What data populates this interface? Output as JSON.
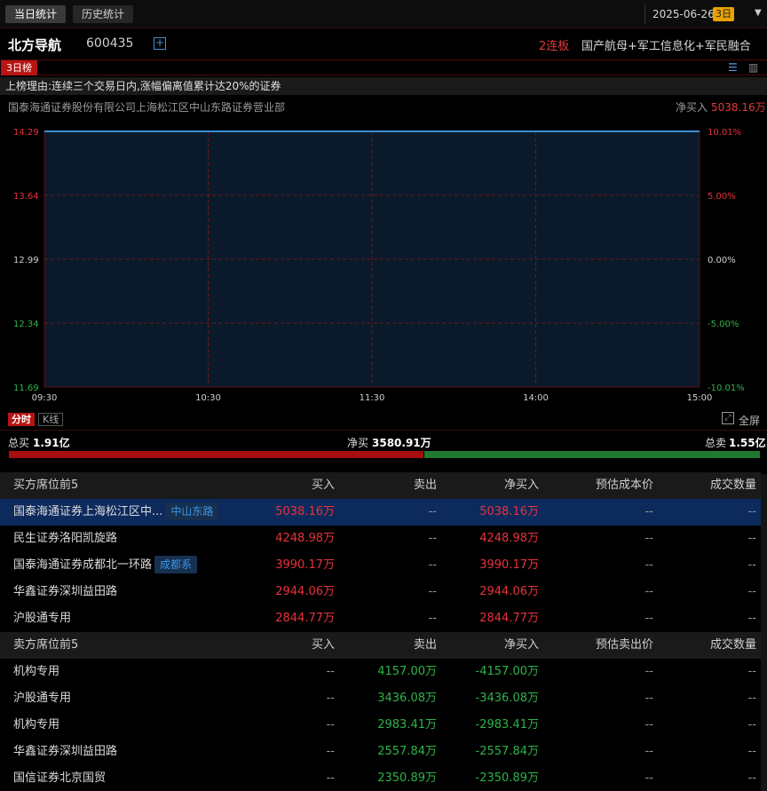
{
  "topbar": {
    "tab_today": "当日统计",
    "tab_history": "历史统计",
    "date": "2025-06-26",
    "days_badge": "3日",
    "dropdown_icon": "chevron-down-icon"
  },
  "stock": {
    "name": "北方导航",
    "code": "600435",
    "add_icon": "plus-square-icon",
    "board_status": "2连板",
    "concepts": "国产航母+军工信息化+军民融合"
  },
  "ranking": {
    "tab_label": "3日榜",
    "reason": "上榜理由:连续三个交易日内,涨幅偏离值累计达20%的证券",
    "seat_name": "国泰海通证券股份有限公司上海松江区中山东路证券营业部",
    "net_buy_label": "净买入",
    "net_buy_value": "5038.16万"
  },
  "chart_data": {
    "type": "line",
    "y_left_ticks": [
      "14.29",
      "13.64",
      "12.99",
      "12.34",
      "11.69"
    ],
    "y_right_ticks": [
      "10.01%",
      "5.00%",
      "0.00%",
      "-5.00%",
      "-10.01%"
    ],
    "x_ticks": [
      "09:30",
      "10:30",
      "11:30",
      "14:00",
      "15:00"
    ],
    "ylim": [
      11.69,
      14.29
    ],
    "series": [
      {
        "values": [
          14.29,
          14.29
        ]
      }
    ],
    "line_color": "#3a8fd8",
    "fill_color": "#0b1a2a",
    "grid": true
  },
  "chart_tabs": {
    "intraday": "分时",
    "kline": "K线",
    "fullscreen": "全屏",
    "fullscreen_icon": "expand-icon"
  },
  "totals": {
    "total_buy_label": "总买",
    "total_buy_value": "1.91亿",
    "net_buy_label": "净买",
    "net_buy_value": "3580.91万",
    "total_sell_label": "总卖",
    "total_sell_value": "1.55亿",
    "buy_share": 0.552,
    "colors": {
      "buy": "#a80e0e",
      "sell": "#1f7a30"
    }
  },
  "buy_table": {
    "headers": [
      "买方席位前5",
      "买入",
      "卖出",
      "净买入",
      "预估成本价",
      "成交数量"
    ],
    "rows": [
      {
        "name": "国泰海通证券上海松江区中...",
        "tag": "中山东路",
        "buy": "5038.16万",
        "sell": "--",
        "net": "5038.16万",
        "cost": "--",
        "volume": "--"
      },
      {
        "name": "民生证券洛阳凯旋路",
        "tag": "",
        "buy": "4248.98万",
        "sell": "--",
        "net": "4248.98万",
        "cost": "--",
        "volume": "--"
      },
      {
        "name": "国泰海通证券成都北一环路",
        "tag": "成都系",
        "buy": "3990.17万",
        "sell": "--",
        "net": "3990.17万",
        "cost": "--",
        "volume": "--"
      },
      {
        "name": "华鑫证券深圳益田路",
        "tag": "",
        "buy": "2944.06万",
        "sell": "--",
        "net": "2944.06万",
        "cost": "--",
        "volume": "--"
      },
      {
        "name": "沪股通专用",
        "tag": "",
        "buy": "2844.77万",
        "sell": "--",
        "net": "2844.77万",
        "cost": "--",
        "volume": "--"
      }
    ]
  },
  "sell_table": {
    "headers": [
      "卖方席位前5",
      "买入",
      "卖出",
      "净买入",
      "预估卖出价",
      "成交数量"
    ],
    "rows": [
      {
        "name": "机构专用",
        "buy": "--",
        "sell": "4157.00万",
        "net": "-4157.00万",
        "cost": "--",
        "volume": "--"
      },
      {
        "name": "沪股通专用",
        "buy": "--",
        "sell": "3436.08万",
        "net": "-3436.08万",
        "cost": "--",
        "volume": "--"
      },
      {
        "name": "机构专用",
        "buy": "--",
        "sell": "2983.41万",
        "net": "-2983.41万",
        "cost": "--",
        "volume": "--"
      },
      {
        "name": "华鑫证券深圳益田路",
        "buy": "--",
        "sell": "2557.84万",
        "net": "-2557.84万",
        "cost": "--",
        "volume": "--"
      },
      {
        "name": "国信证券北京国贸",
        "buy": "--",
        "sell": "2350.89万",
        "net": "-2350.89万",
        "cost": "--",
        "volume": "--"
      }
    ]
  }
}
